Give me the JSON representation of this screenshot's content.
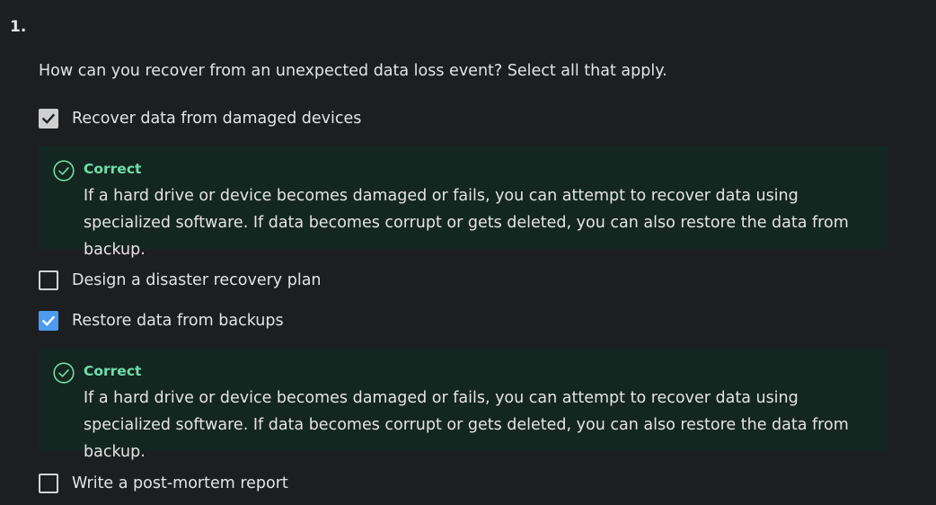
{
  "question": {
    "number": "1.",
    "text": "How can you recover from an unexpected data loss event? Select all that apply."
  },
  "options": [
    {
      "label": "Recover data from damaged devices",
      "checked": true,
      "feedback": {
        "title": "Correct",
        "text": "If a hard drive or device becomes damaged or fails, you can attempt to recover data using specialized software. If data becomes corrupt or gets deleted, you can also restore the data from backup."
      }
    },
    {
      "label": "Design a disaster recovery plan",
      "checked": false
    },
    {
      "label": "Restore data from backups",
      "checked": true,
      "feedback": {
        "title": "Correct",
        "text": "If a hard drive or device becomes damaged or fails, you can attempt to recover data using specialized software. If data becomes corrupt or gets deleted, you can also restore the data from backup."
      }
    },
    {
      "label": "Write a post-mortem report",
      "checked": false
    }
  ],
  "colors": {
    "background": "#1d1e20",
    "feedback_bg": "#142620",
    "correct_green": "#6fdfaa",
    "checkbox_blue": "#4c9bf0",
    "checkbox_grey": "#cfcfcf"
  },
  "icons": {
    "check": "checkmark-icon",
    "correct": "check-circle-icon"
  }
}
